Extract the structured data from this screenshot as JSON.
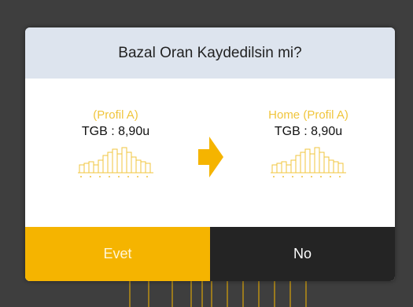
{
  "dialog": {
    "title": "Bazal Oran Kaydedilsin mi?",
    "source_profile": {
      "name": "(Profil A)",
      "tgb": "TGB : 8,90u"
    },
    "target_profile": {
      "name": "Home (Profil A)",
      "tgb": "TGB : 8,90u"
    },
    "arrow_icon": "arrow-right-icon",
    "yes_label": "Evet",
    "no_label": "No"
  },
  "colors": {
    "accent": "#f5b400",
    "header_bg": "#dde4ee",
    "no_bg": "#242424",
    "chart_stroke": "#f0c53c"
  },
  "basal_profile_icon": "basal-profile-chart-icon"
}
